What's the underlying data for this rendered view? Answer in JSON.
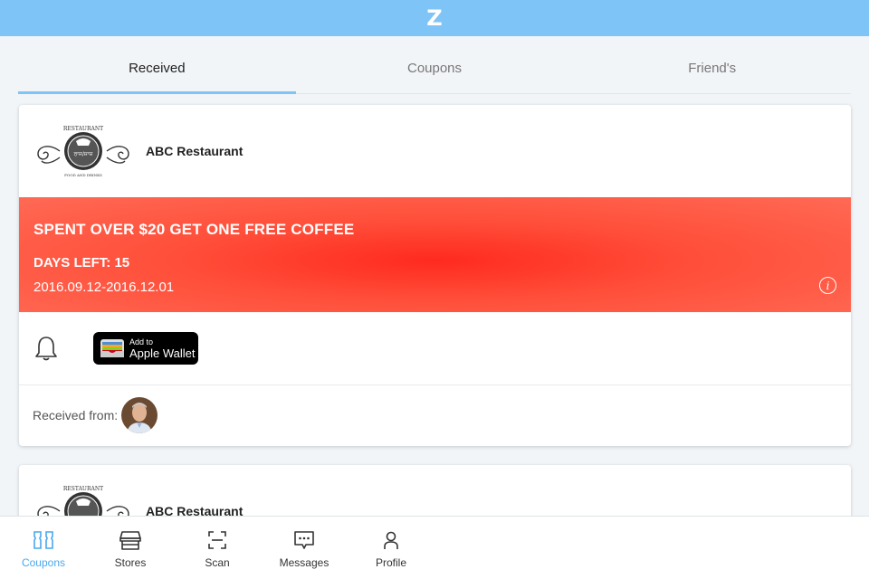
{
  "app": {
    "logo_text": "Z"
  },
  "tabs": [
    {
      "label": "Received",
      "active": true
    },
    {
      "label": "Coupons",
      "active": false
    },
    {
      "label": "Friend's",
      "active": false
    }
  ],
  "cards": [
    {
      "store_name": "ABC Restaurant",
      "store_logo": {
        "top_text": "RESTAURANT",
        "center_text": "ਰਾਜ/ਜ਼ਾਜ਼",
        "bottom_text": "FOOD AND DRINKS"
      },
      "coupon": {
        "title": "SPENT OVER $20 GET ONE FREE COFFEE",
        "days_left": "DAYS LEFT: 15",
        "dates": "2016.09.12-2016.12.01",
        "background_color": "#ff3b2f"
      },
      "wallet_button": {
        "small": "Add to",
        "big": "Apple Wallet"
      },
      "received_from_label": "Received from:"
    },
    {
      "store_name": "ABC Restaurant"
    }
  ],
  "bottom_nav": [
    {
      "label": "Coupons",
      "icon": "coupons-icon",
      "active": true
    },
    {
      "label": "Stores",
      "icon": "store-icon",
      "active": false
    },
    {
      "label": "Scan",
      "icon": "scan-icon",
      "active": false
    },
    {
      "label": "Messages",
      "icon": "messages-icon",
      "active": false
    },
    {
      "label": "Profile",
      "icon": "profile-icon",
      "active": false
    }
  ],
  "colors": {
    "accent": "#7fc4f7",
    "active_nav": "#4aa8ec"
  }
}
